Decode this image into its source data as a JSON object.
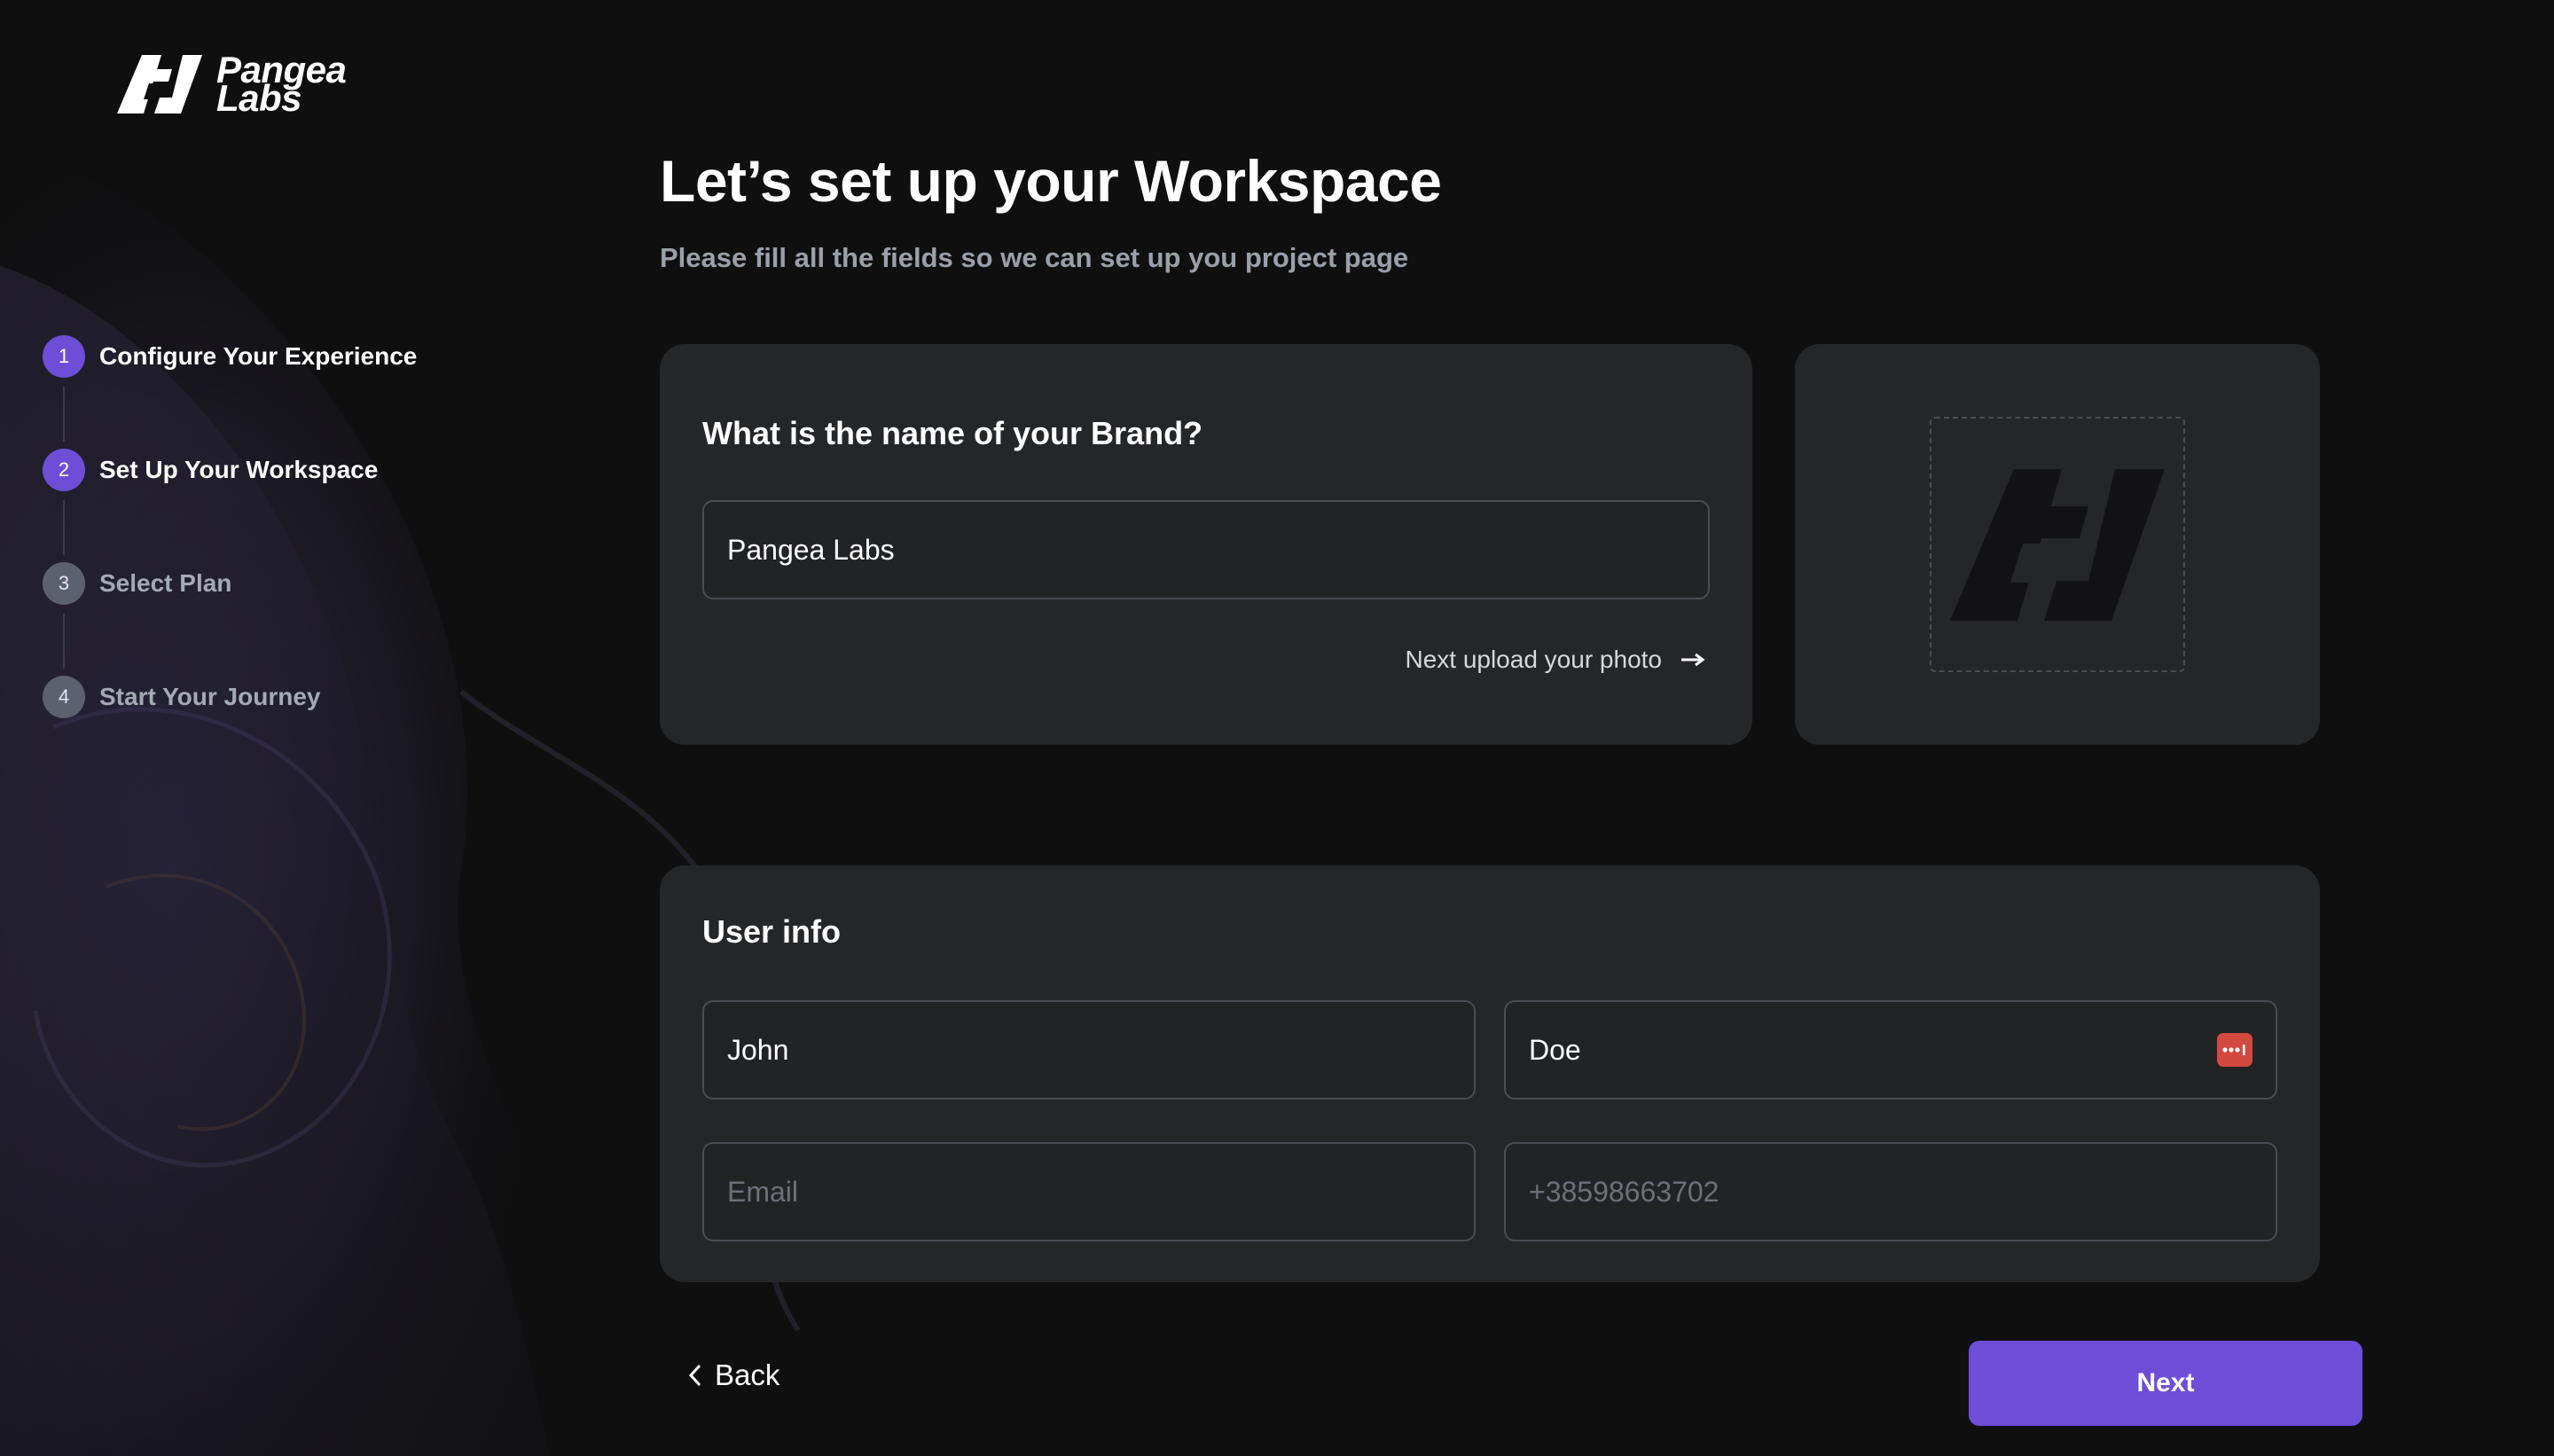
{
  "brand": {
    "name_line1": "Pangea",
    "name_line2": "Labs"
  },
  "stepper": {
    "steps": [
      {
        "number": "1",
        "label": "Configure Your Experience",
        "state": "active"
      },
      {
        "number": "2",
        "label": "Set Up Your Workspace",
        "state": "active"
      },
      {
        "number": "3",
        "label": "Select Plan",
        "state": "inactive"
      },
      {
        "number": "4",
        "label": "Start Your Journey",
        "state": "inactive"
      }
    ]
  },
  "header": {
    "title": "Let’s set up your Workspace",
    "subtitle": "Please fill all the fields so we can set up you project page"
  },
  "brand_card": {
    "heading": "What is the name of your Brand?",
    "brand_name_value": "Pangea Labs",
    "upload_link_label": "Next upload your photo"
  },
  "photo_card": {
    "preview_icon": "pangea-logo-mark"
  },
  "user_info": {
    "heading": "User info",
    "first_name_value": "John",
    "last_name_value": "Doe",
    "email_placeholder": "Email",
    "phone_placeholder": "+38598663702",
    "autofill_icon": "password-manager-icon"
  },
  "footer": {
    "back_label": "Back",
    "next_label": "Next"
  },
  "colors": {
    "accent": "#6e4ed6",
    "background": "#0f0f10",
    "card": "#252628",
    "step_inactive": "#5a6270",
    "password_badge": "#d2493f"
  }
}
